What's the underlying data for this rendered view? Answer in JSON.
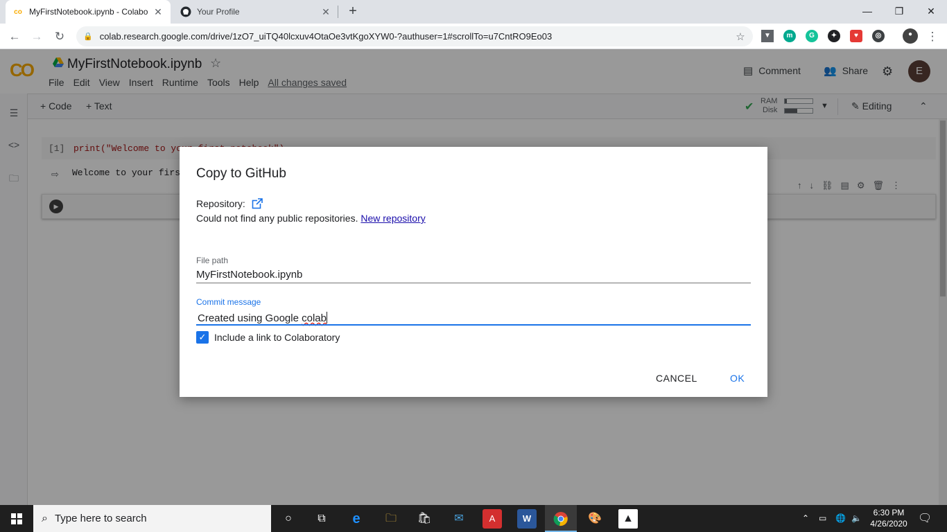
{
  "browser": {
    "tabs": [
      {
        "title": "MyFirstNotebook.ipynb - Colabo",
        "favicon": "colab-icon",
        "active": true
      },
      {
        "title": "Your Profile",
        "favicon": "github-icon",
        "active": false
      }
    ],
    "url": "colab.research.google.com/drive/1zO7_uiTQ40lcxuv4OtaOe3vtKgoXYW0-?authuser=1#scrollTo=u7CntRO9Eo03"
  },
  "colab": {
    "logo_text": "CO",
    "notebook_title": "MyFirstNotebook.ipynb",
    "menu": [
      "File",
      "Edit",
      "View",
      "Insert",
      "Runtime",
      "Tools",
      "Help"
    ],
    "save_status": "All changes saved",
    "comment_label": "Comment",
    "share_label": "Share",
    "avatar_letter": "E",
    "add_code_label": "+ Code",
    "add_text_label": "+ Text",
    "ram_label": "RAM",
    "disk_label": "Disk",
    "ram_usage": 0.08,
    "disk_usage": 0.45,
    "editing_label": "Editing",
    "cell_prompt": "[1]",
    "cell_code": "print(\"Welcome to your first notebook\")",
    "cell_output": "Welcome to your first notebook"
  },
  "dialog": {
    "title": "Copy to GitHub",
    "repository_label": "Repository:",
    "repo_message": "Could not find any public repositories.",
    "new_repo_link": "New repository",
    "file_path_label": "File path",
    "file_path_value": "MyFirstNotebook.ipynb",
    "commit_label": "Commit message",
    "commit_value_plain": "Created using Google ",
    "commit_value_misspelled": "colab",
    "include_link_label": "Include a link to Colaboratory",
    "include_link_checked": true,
    "cancel_label": "CANCEL",
    "ok_label": "OK"
  },
  "taskbar": {
    "search_placeholder": "Type here to search",
    "time": "6:30 PM",
    "date": "4/26/2020"
  },
  "colors": {
    "accent_blue": "#1a73e8",
    "colab_orange": "#f9ab00",
    "link": "#1a0dab"
  }
}
